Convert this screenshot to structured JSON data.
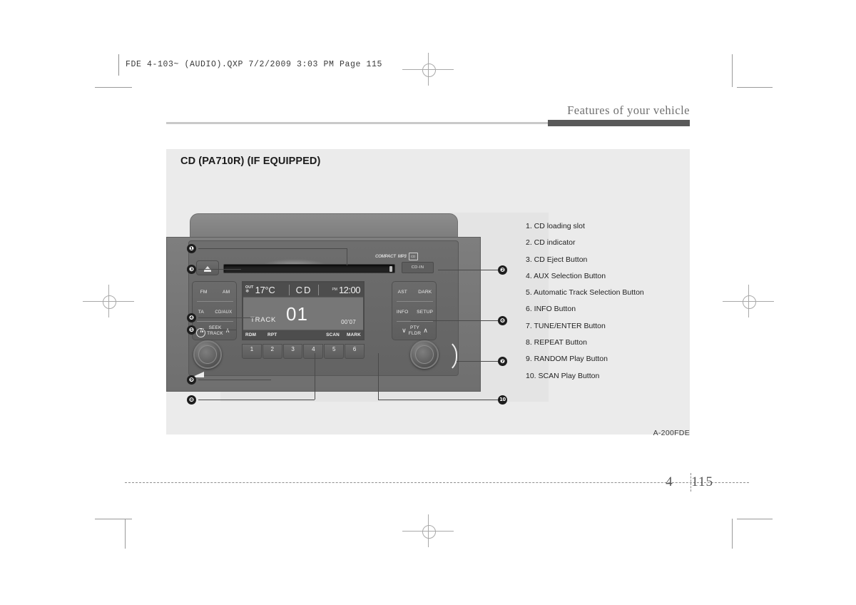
{
  "prepress": {
    "slug": "FDE 4-103~ (AUDIO).QXP   7/2/2009   3:03 PM   Page 115"
  },
  "header": {
    "running_head": "Features of your vehicle"
  },
  "figure": {
    "title": "CD (PA710R) (IF EQUIPPED)",
    "code": "A-200FDE"
  },
  "head_unit": {
    "eject_icon": "eject-icon",
    "cd_in_label": "CD-IN",
    "logos": {
      "cd": "COMPACT",
      "mp3": "MP3",
      "box": "CD"
    },
    "left_cluster": {
      "r1a": "FM",
      "r1b": "AM",
      "r2a": "TA",
      "r2b": "CD/AUX",
      "seek_line1": "SEEK",
      "seek_line2": "TRACK",
      "chev_left": "∨",
      "chev_right": "∧"
    },
    "right_cluster": {
      "r1a": "AST",
      "r1b": "DARK",
      "r2a": "INFO",
      "r2b": "SETUP",
      "seek_line1": "PTY",
      "seek_line2": "FLDR",
      "chev_left": "∨",
      "chev_right": "∧"
    },
    "display": {
      "out_label": "OUT",
      "out_symbol": "❄",
      "temperature": "17°C",
      "mode": "CD",
      "am_pm": "PM",
      "clock": "12:00",
      "track_label": "TRACK",
      "track_number": "01",
      "elapsed": "00'07",
      "flag_rdm": "RDM",
      "flag_rpt": "RPT",
      "flag_scan": "SCAN",
      "flag_mark": "MARK"
    },
    "presets": [
      "1",
      "2",
      "3",
      "4",
      "5",
      "6"
    ],
    "power_icon": "power-icon",
    "volume_icon": "volume-wedge-icon",
    "tune_knob": "tune-enter-knob"
  },
  "callouts": {
    "n1": "❶",
    "n2": "❷",
    "n3": "❸",
    "n4": "❹",
    "n5": "❺",
    "n6": "❻",
    "n7": "❼",
    "n8": "❽",
    "n9": "❾",
    "n10": "10"
  },
  "legend": {
    "items": [
      "1. CD loading slot",
      "2. CD indicator",
      "3. CD Eject Button",
      "4. AUX Selection Button",
      "5. Automatic Track Selection Button",
      "6. INFO Button",
      "7. TUNE/ENTER Button",
      "8. REPEAT Button",
      "9. RANDOM Play Button",
      "10. SCAN Play Button"
    ]
  },
  "footer": {
    "chapter": "4",
    "page": "115"
  },
  "colors": {
    "panel_bg": "#ebebeb",
    "rule_dark": "#595959",
    "text": "#222222"
  }
}
